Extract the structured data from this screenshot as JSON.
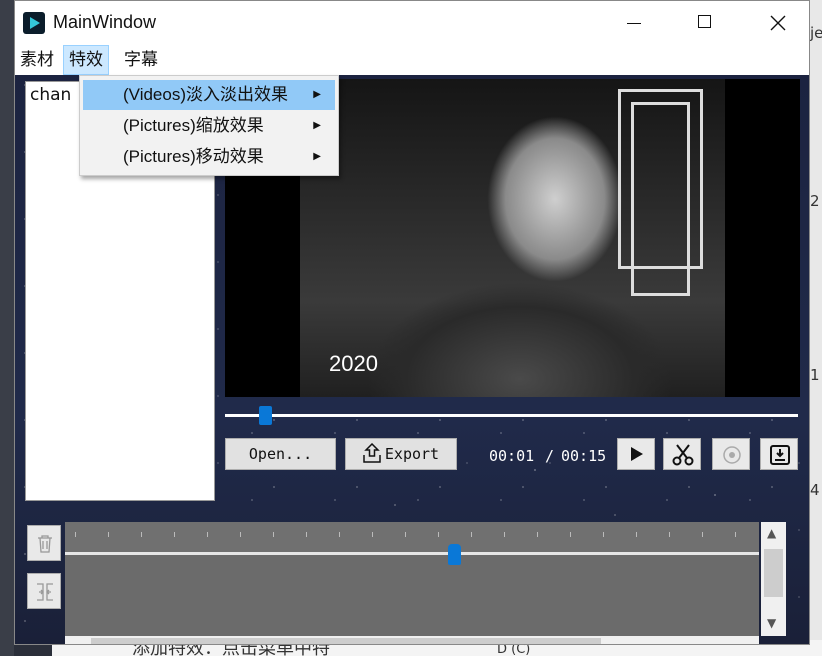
{
  "window": {
    "title": "MainWindow"
  },
  "menubar": {
    "items": [
      "素材",
      "特效",
      "字幕"
    ],
    "active_index": 1
  },
  "dropdown": {
    "items": [
      {
        "label": "(Videos)淡入淡出效果",
        "highlighted": true
      },
      {
        "label": "(Pictures)缩放效果",
        "highlighted": false
      },
      {
        "label": "(Pictures)移动效果",
        "highlighted": false
      }
    ]
  },
  "list_panel": {
    "items": [
      "chan"
    ]
  },
  "video": {
    "caption": "2020"
  },
  "progress_slider": {
    "value": 0.07
  },
  "controls": {
    "open_label": "Open...",
    "export_label": "Export",
    "time_current": "00:01",
    "time_separator": "/",
    "time_total": "00:15"
  },
  "timeline": {
    "playhead": 0.56
  },
  "background": {
    "bottom_text": "添加特效：点击菜单中特",
    "bottom_text2": "D (C)",
    "right_chars": [
      "je",
      "2",
      "1",
      "4"
    ]
  },
  "colors": {
    "accent": "#0a78d7",
    "menu_highlight": "#91c9f7"
  }
}
